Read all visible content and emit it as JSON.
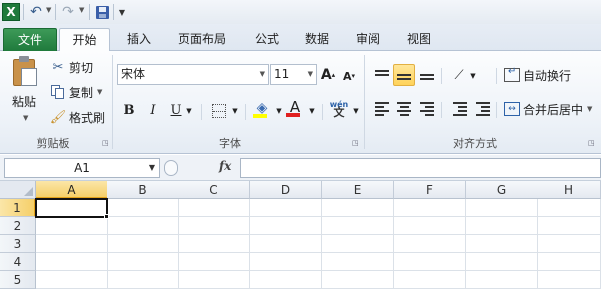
{
  "qat": {
    "logo": "X",
    "icons": [
      "excel-logo-icon",
      "undo-icon",
      "redo-icon",
      "save-icon",
      "customize-qat-icon"
    ]
  },
  "tabs": [
    "文件",
    "开始",
    "插入",
    "页面布局",
    "公式",
    "数据",
    "审阅",
    "视图"
  ],
  "active_tab": "开始",
  "clipboard": {
    "paste": "粘贴",
    "cut": "剪切",
    "copy": "复制",
    "format_painter": "格式刷",
    "group_label": "剪贴板"
  },
  "font": {
    "family": "宋体",
    "size": "11",
    "bold": "B",
    "italic": "I",
    "underline": "U",
    "phonetic": "wén",
    "group_label": "字体"
  },
  "alignment": {
    "wrap_text": "自动换行",
    "merge_center": "合并后居中",
    "group_label": "对齐方式"
  },
  "formula_bar": {
    "name_box": "A1",
    "fx": "fx",
    "formula": ""
  },
  "sheet": {
    "columns": [
      "A",
      "B",
      "C",
      "D",
      "E",
      "F",
      "G",
      "H"
    ],
    "rows": [
      "1",
      "2",
      "3",
      "4",
      "5"
    ],
    "selected_cell": "A1"
  },
  "colors": {
    "file_tab": "#1f7a3c",
    "selection_highlight": "#f5cf69",
    "fill_color": "#ffff00",
    "font_color": "#e02020"
  }
}
